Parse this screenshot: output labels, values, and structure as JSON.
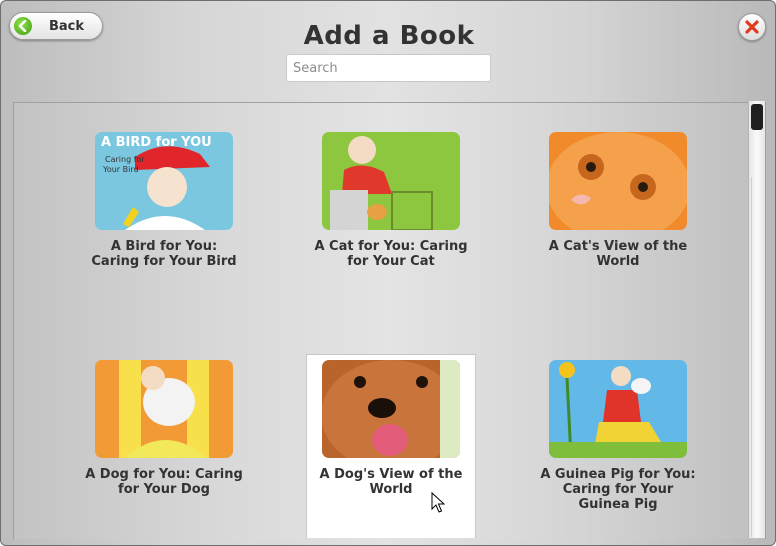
{
  "header": {
    "back_label": "Back",
    "title": "Add a Book",
    "search_placeholder": "Search"
  },
  "books": [
    {
      "title": "A Bird for You: Caring for Your Bird",
      "cover_color": "#7cc7e0"
    },
    {
      "title": "A Cat for You: Caring for Your Cat",
      "cover_color": "#8dc63f"
    },
    {
      "title": "A Cat's View of the World",
      "cover_color": "#f08a2a"
    },
    {
      "title": "A Dog for You: Caring for Your Dog",
      "cover_color": "#f29b36"
    },
    {
      "title": "A Dog's View of the World",
      "cover_color": "#b8642a",
      "selected": true
    },
    {
      "title": "A Guinea Pig for You: Caring for Your Guinea Pig",
      "cover_color": "#62b9e8"
    }
  ],
  "icons": {
    "back": "back-arrow-icon",
    "close": "close-x-icon"
  },
  "colors": {
    "back_green": "#4aa81a",
    "close_red": "#e23a1f"
  }
}
